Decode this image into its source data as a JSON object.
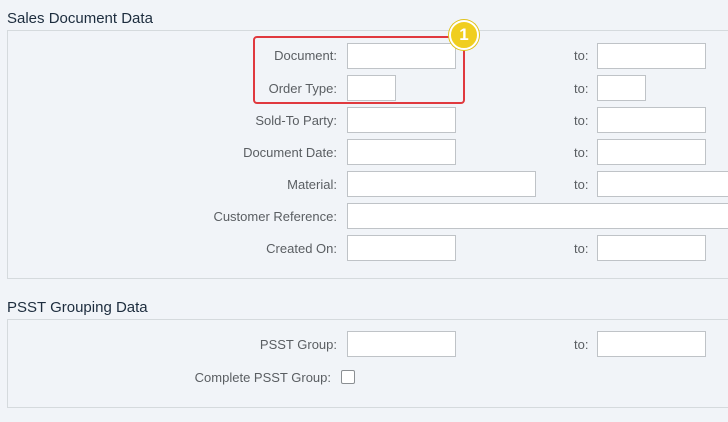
{
  "sales": {
    "title": "Sales Document Data",
    "document_label": "Document:",
    "order_type_label": "Order Type:",
    "sold_to_label": "Sold-To Party:",
    "doc_date_label": "Document Date:",
    "material_label": "Material:",
    "cust_ref_label": "Customer Reference:",
    "created_on_label": "Created On:",
    "to_label": "to:"
  },
  "psst": {
    "title": "PSST Grouping Data",
    "group_label": "PSST Group:",
    "complete_label": "Complete PSST Group:",
    "to_label": "to:",
    "complete_checked": false
  },
  "annotation": {
    "step_number": "1",
    "highlight_color": "#e0393e",
    "badge_color": "#f0ce1f"
  }
}
